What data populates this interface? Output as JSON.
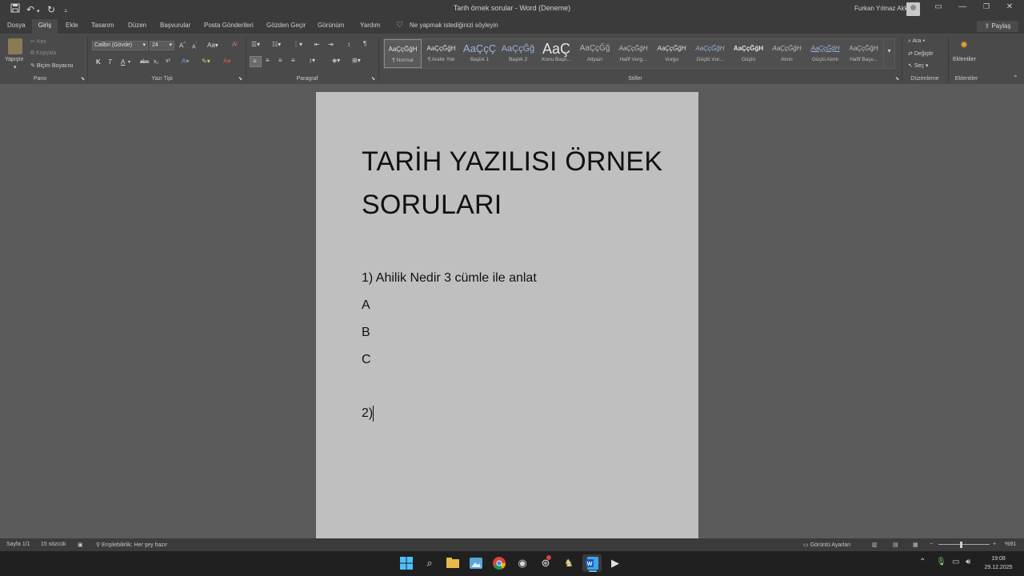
{
  "window": {
    "title": "Tarih örnek sorular  -  Word (Deneme)",
    "user": "Furkan Yılmaz Akkus",
    "share_label": "Paylaş"
  },
  "menu": {
    "tabs": [
      "Dosya",
      "Giriş",
      "Ekle",
      "Tasarım",
      "Düzen",
      "Başvurular",
      "Posta Gönderileri",
      "Gözden Geçir",
      "Görünüm",
      "Yardım"
    ],
    "tell_me": "Ne yapmak istediğinizi söyleyin"
  },
  "ribbon": {
    "clipboard": {
      "paste": "Yapıştır",
      "cut": "Kes",
      "copy": "Kopyala",
      "format_painter": "Biçim Boyacısı",
      "group": "Pano"
    },
    "font": {
      "name": "Calibri (Gövde)",
      "size": "24",
      "bold": "K",
      "italic": "T",
      "underline": "A",
      "group": "Yazı Tipi"
    },
    "paragraph": {
      "group": "Paragraf"
    },
    "styles": {
      "group": "Stiller",
      "items": [
        {
          "preview": "AaÇçĞğH",
          "name": "¶ Normal"
        },
        {
          "preview": "AaÇçĞğH",
          "name": "¶ Aralık Yok"
        },
        {
          "preview": "AaÇçÇ",
          "name": "Başlık 1"
        },
        {
          "preview": "AaÇçĞğ",
          "name": "Başlık 2"
        },
        {
          "preview": "AaÇ",
          "name": "Konu Başlı..."
        },
        {
          "preview": "AaÇçĞğ",
          "name": "Altyazı"
        },
        {
          "preview": "AaÇçĞğH",
          "name": "Hafif Vurg..."
        },
        {
          "preview": "AaÇçĞğH",
          "name": "Vurgu"
        },
        {
          "preview": "AaÇçĞğH",
          "name": "Güçlü Vur..."
        },
        {
          "preview": "AaÇçĞğH",
          "name": "Güçlü"
        },
        {
          "preview": "AaÇçĞğH",
          "name": "Alıntı"
        },
        {
          "preview": "AaÇçĞğH",
          "name": "Güçlü Alıntı"
        },
        {
          "preview": "AaÇçĞğH",
          "name": "Hafif Başv..."
        }
      ]
    },
    "editing": {
      "find": "Ara",
      "replace": "Değiştir",
      "select": "Seç",
      "group": "Düzenleme"
    },
    "addins": {
      "label": "Eklentiler",
      "group": "Eklentiler"
    }
  },
  "document": {
    "title_line1": "TARİH YAZILISI ÖRNEK",
    "title_line2": "SORULARI",
    "question1": "1) Ahilik Nedir 3 cümle ile anlat",
    "option_a": "A",
    "option_b": "B",
    "option_c": "C",
    "question2": "2)"
  },
  "status": {
    "page": "Sayfa 1/1",
    "words": "15 sözcük",
    "accessibility": "Erişilebilirlik: Her şey hazır",
    "display_settings": "Görüntü Ayarları",
    "zoom": "%91",
    "zoom_level": 0.45
  },
  "taskbar": {
    "time": "19:08",
    "date": "29.12.2025"
  },
  "colors": {
    "accent": "#2b579a",
    "page_background": "#bfbfbf",
    "workspace": "#5b5b5b"
  }
}
